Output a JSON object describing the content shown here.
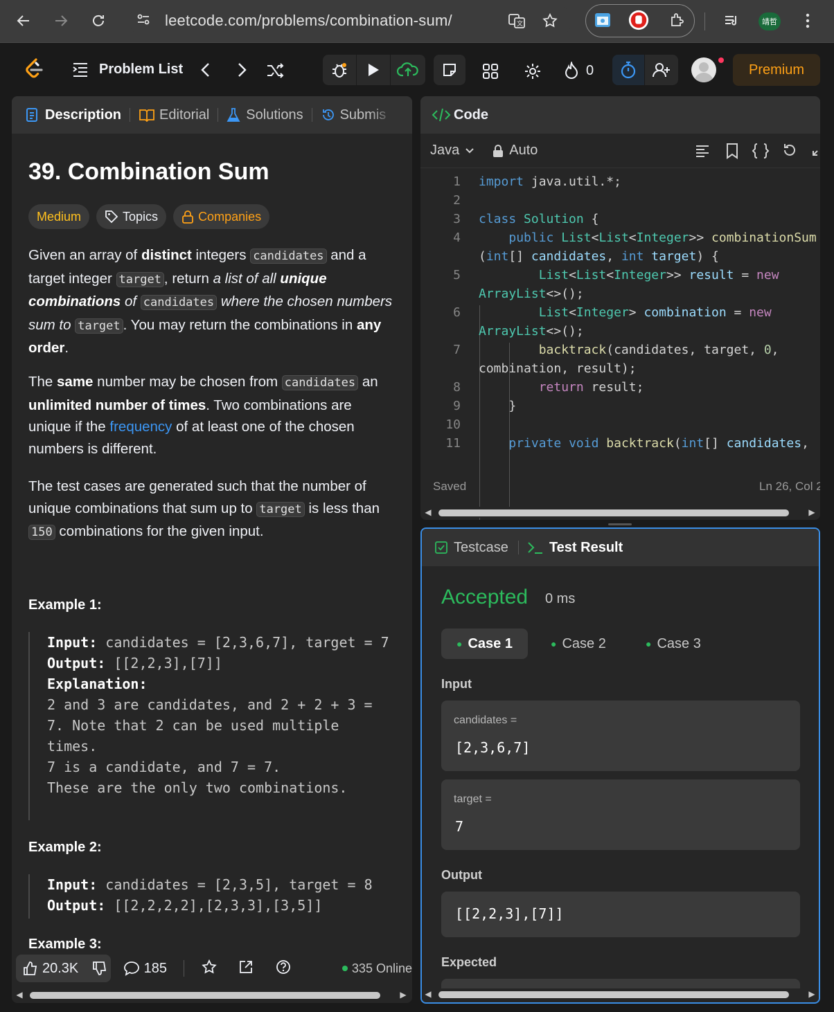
{
  "browser": {
    "url": "leetcode.com/problems/combination-sum/",
    "profile": "靖哲"
  },
  "nav": {
    "problem_list": "Problem List",
    "streak": "0",
    "premium": "Premium"
  },
  "left_tabs": [
    "Description",
    "Editorial",
    "Solutions",
    "Submis"
  ],
  "problem": {
    "title": "39. Combination Sum",
    "difficulty": "Medium",
    "topics": "Topics",
    "companies": "Companies",
    "p1": {
      "t1": "Given an array of ",
      "b1": "distinct",
      "t2": " integers ",
      "c1": "candidates",
      "t3": " and a target integer ",
      "c2": "target",
      "t4": ", return ",
      "i1": "a list of all ",
      "bi1": "unique combinations",
      "i2": " of ",
      "c3": "candidates",
      "i3": " where the chosen numbers sum to ",
      "c4": "target",
      "t5": ". You may return the combinations in ",
      "b2": "any order",
      "t6": "."
    },
    "p2": {
      "t1": "The ",
      "b1": "same",
      "t2": " number may be chosen from ",
      "c1": "candidates",
      "t3": " an ",
      "b2": "unlimited number of times",
      "t4": ". Two combinations are unique if the ",
      "link": "frequency",
      "t5": " of at least one of the chosen numbers is different."
    },
    "p3": {
      "t1": "The test cases are generated such that the number of unique combinations that sum up to ",
      "c1": "target",
      "t2": " is less than ",
      "c2": "150",
      "t3": " combinations for the given input."
    },
    "examples": [
      {
        "title": "Example 1:",
        "input_label": "Input:",
        "input": " candidates = [2,3,6,7], target = 7",
        "output_label": "Output:",
        "output": " [[2,2,3],[7]]",
        "explanation_label": "Explanation:",
        "explanation": "2 and 3 are candidates, and 2 + 2 + 3 = 7. Note that 2 can be used multiple times.\n7 is a candidate, and 7 = 7.\nThese are the only two combinations."
      },
      {
        "title": "Example 2:",
        "input_label": "Input:",
        "input": " candidates = [2,3,5], target = 8",
        "output_label": "Output:",
        "output": " [[2,2,2,2],[2,3,3],[3,5]]"
      },
      {
        "title": "Example 3:"
      }
    ]
  },
  "footer": {
    "likes": "20.3K",
    "comments": "185",
    "online": "335 Online"
  },
  "code": {
    "header": "Code",
    "language": "Java",
    "mode": "Auto",
    "status": "Saved",
    "cursor": "Ln 26, Col 2",
    "line_numbers": [
      "1",
      "2",
      "3",
      "4",
      "5",
      "6",
      "7",
      "8",
      "9",
      "10",
      "11"
    ]
  },
  "result": {
    "tab_testcase": "Testcase",
    "tab_result": "Test Result",
    "verdict": "Accepted",
    "runtime": "0 ms",
    "cases": [
      "Case 1",
      "Case 2",
      "Case 3"
    ],
    "input_label": "Input",
    "inputs": [
      {
        "name": "candidates =",
        "value": "[2,3,6,7]"
      },
      {
        "name": "target =",
        "value": "7"
      }
    ],
    "output_label": "Output",
    "output": "[[2,2,3],[7]]",
    "expected_label": "Expected"
  },
  "colors": {
    "accepted": "#2cbb5d",
    "medium": "#ffc01e",
    "premium": "#ffa116",
    "link": "#3c97f5",
    "focus": "#3a8ee6"
  }
}
